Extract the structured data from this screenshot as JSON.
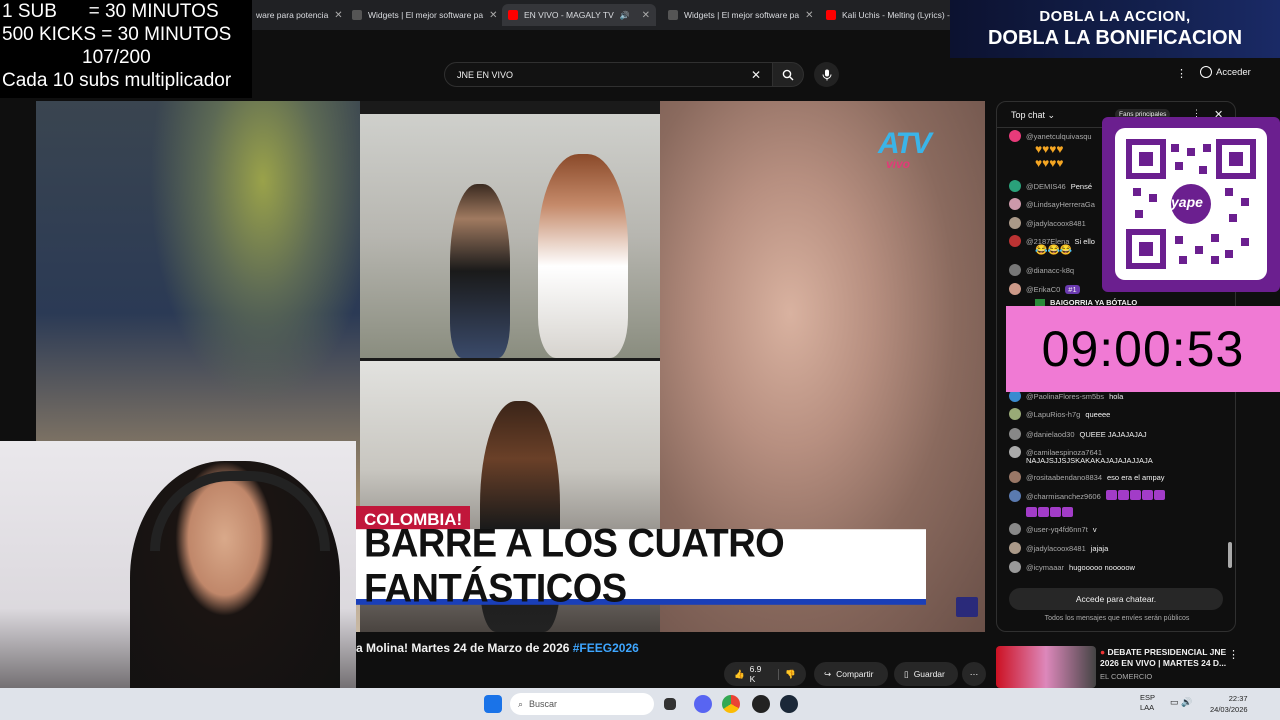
{
  "overlay": {
    "line1": "1 SUB      = 30 MINUTOS",
    "line2": "500 KICKS = 30 MINUTOS",
    "line3": "107/200",
    "line4": "Cada 10 subs multiplicador"
  },
  "promo": {
    "line1": "DOBLA LA ACCION,",
    "line2": "DOBLA LA BONIFICACION"
  },
  "tabs": [
    {
      "label": "ware para potencia",
      "color": "#888"
    },
    {
      "label": "Widgets | El mejor software pa",
      "color": "#888"
    },
    {
      "label": "EN VIVO - MAGALY TV",
      "color": "#ff0000"
    },
    {
      "label": "Widgets | El mejor software pa",
      "color": "#888"
    },
    {
      "label": "Kali Uchis - Melting (Lyrics) - Y",
      "color": "#ff0000"
    }
  ],
  "search": {
    "query": "JNE EN VIVO"
  },
  "header": {
    "acceder": "Acceder"
  },
  "video": {
    "atv": "ATV",
    "atv_sub": "vivo",
    "tag": "COLOMBIA!",
    "headline": "BARRE A LOS CUATRO FANTÁSTICOS"
  },
  "chat": {
    "mode": "Top chat",
    "fans": "Fans principales",
    "messages": [
      {
        "author": "@yanetculquivasqu",
        "text": "",
        "color": "#e83b7a"
      },
      {
        "author": "@DEMIS46",
        "text": "Pensé",
        "color": "#2aa17a"
      },
      {
        "author": "@LindsayHerreraGa",
        "text": "",
        "color": "#c9a"
      },
      {
        "author": "@jadylacoox8481",
        "text": "",
        "color": "#a98"
      },
      {
        "author": "@2187Elena",
        "text": "Si ello",
        "color": "#b33"
      },
      {
        "author": "@dianacc-k8q",
        "text": "",
        "color": "#777"
      },
      {
        "author": "@ErikaC0",
        "text": "#1",
        "color": "#c98"
      },
      {
        "author": "",
        "text": "BAIGORRIA YA BÓTALO",
        "color": "#0f0f0f"
      },
      {
        "author": "@PaolinaFlores-sm5bs",
        "text": "hola",
        "color": "#3a8bd0"
      },
      {
        "author": "@LapuRios-h7g",
        "text": "queeee",
        "color": "#9a7"
      },
      {
        "author": "@danielaod30",
        "text": "QUEEE JAJAJAJAJ",
        "color": "#888"
      },
      {
        "author": "@camilaespinoza7641",
        "text": "NAJAJSJJSJSKAKAKAJAJAJAJJAJA",
        "color": "#aaa"
      },
      {
        "author": "@rositaabendano8834",
        "text": "eso era el ampay",
        "color": "#976"
      },
      {
        "author": "@charmisanchez9606",
        "text": "",
        "color": "#5a7ab0"
      },
      {
        "author": "@user-yq4fd6nn7t",
        "text": "v",
        "color": "#888"
      },
      {
        "author": "@jadylacoox8481",
        "text": "jajaja",
        "color": "#a98"
      },
      {
        "author": "@icymaaar",
        "text": "hugooooo nooooow",
        "color": "#999"
      }
    ],
    "input": "Accede para chatear.",
    "note": "Todos los mensajes que envíes serán públicos"
  },
  "qr": {
    "brand": "yape"
  },
  "timer": {
    "value": "09:00:53"
  },
  "below": {
    "title_plain": "a Molina! Martes 24 de Marzo de 2026 ",
    "title_tag": "#FEEG2026",
    "likes": "6.9 K",
    "share": "Compartir",
    "save": "Guardar"
  },
  "recommended": {
    "title": "DEBATE PRESIDENCIAL JNE 2026 EN VIVO | MARTES 24 D...",
    "channel": "EL COMERCIO"
  },
  "taskbar": {
    "search": "Buscar",
    "lang1": "ESP",
    "lang2": "LAA",
    "time": "22:37",
    "date": "24/03/2026"
  }
}
